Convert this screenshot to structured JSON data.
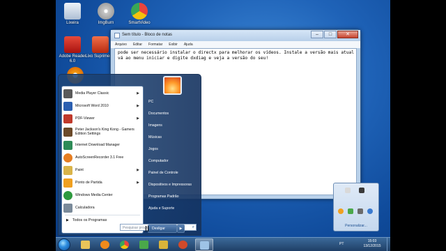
{
  "desktop_icons": [
    {
      "name": "recycle-bin-icon",
      "label": "Lixeira",
      "color": "#c9d6e6"
    },
    {
      "name": "imgburn-icon",
      "label": "ImgBurn",
      "color": "#d8d8d8"
    },
    {
      "name": "chrome-icon",
      "label": "SmartVideo",
      "color": "#e8453c"
    },
    {
      "name": "adobe-reader-icon",
      "label": "Adobe Reader 6.0",
      "color": "#c8201e"
    },
    {
      "name": "lixo-icon",
      "label": "Lixo Suprimento",
      "color": "#e04020"
    },
    {
      "name": "avast-icon",
      "label": "",
      "color": "#f39c12"
    }
  ],
  "notepad": {
    "title": "Sem título - Bloco de notas",
    "menu": [
      "Arquivo",
      "Editar",
      "Formatar",
      "Exibir",
      "Ajuda"
    ],
    "text": "pode ser necessário instalar o directx para melhorar os vídeos. Instale a versão mais atual e\nvá ao menu iniciar e digite dxdiag e veja a versão do seu!"
  },
  "start_menu": {
    "programs": [
      {
        "label": "Media Player Classic",
        "icon": "media-player-classic-icon",
        "color": "#5a5a5a",
        "arrow": true
      },
      {
        "label": "Microsoft Word 2010",
        "icon": "word-icon",
        "color": "#2b5fb0",
        "arrow": true
      },
      {
        "label": "PDF-Viewer",
        "icon": "pdf-viewer-icon",
        "color": "#c0392b",
        "arrow": true
      },
      {
        "label": "Peter Jackson's King Kong - Gamers Edition Settings",
        "icon": "king-kong-icon",
        "color": "#6b4a2a",
        "arrow": false
      },
      {
        "label": "Internet Download Manager",
        "icon": "idm-icon",
        "color": "#2e8b57",
        "arrow": false
      },
      {
        "label": "AutoScreenRecorder 3.1 Free",
        "icon": "screen-recorder-icon",
        "color": "#e67e22",
        "arrow": false
      },
      {
        "label": "Paint",
        "icon": "paint-icon",
        "color": "#d9b44a",
        "arrow": true
      },
      {
        "label": "Ponto de Partida",
        "icon": "getting-started-icon",
        "color": "#f0a020",
        "arrow": true
      },
      {
        "label": "Windows Media Center",
        "icon": "media-center-icon",
        "color": "#2e9a3f",
        "arrow": false
      },
      {
        "label": "Calculadora",
        "icon": "calculator-icon",
        "color": "#7a8a9a",
        "arrow": false
      }
    ],
    "all_programs": "Todos os Programas",
    "search_placeholder": "Pesquisar programas e arquivos",
    "right_links": [
      "PC",
      "Documentos",
      "Imagens",
      "Músicas",
      "Jogos",
      "Computador",
      "Painel de Controle",
      "Dispositivos e Impressoras",
      "Programas Padrão",
      "Ajuda e Suporte"
    ],
    "shutdown": "Desligar"
  },
  "tray_popup": {
    "customize": "Personalizar..."
  },
  "taskbar": {
    "pinned": [
      {
        "icon": "explorer-icon",
        "color": "#e8c45a"
      },
      {
        "icon": "media-player-icon",
        "color": "#f08a1c"
      },
      {
        "icon": "chrome-taskbar-icon",
        "color": "#e8453c"
      },
      {
        "icon": "photo-viewer-icon",
        "color": "#4aa84a"
      },
      {
        "icon": "movie-maker-icon",
        "color": "#d9b43a"
      },
      {
        "icon": "media-player-classic-taskbar-icon",
        "color": "#d04a2a"
      },
      {
        "icon": "notepad-taskbar-icon",
        "color": "#9ec3e6"
      }
    ],
    "language": "PT",
    "time": "15:03",
    "date": "13/12/2015"
  }
}
